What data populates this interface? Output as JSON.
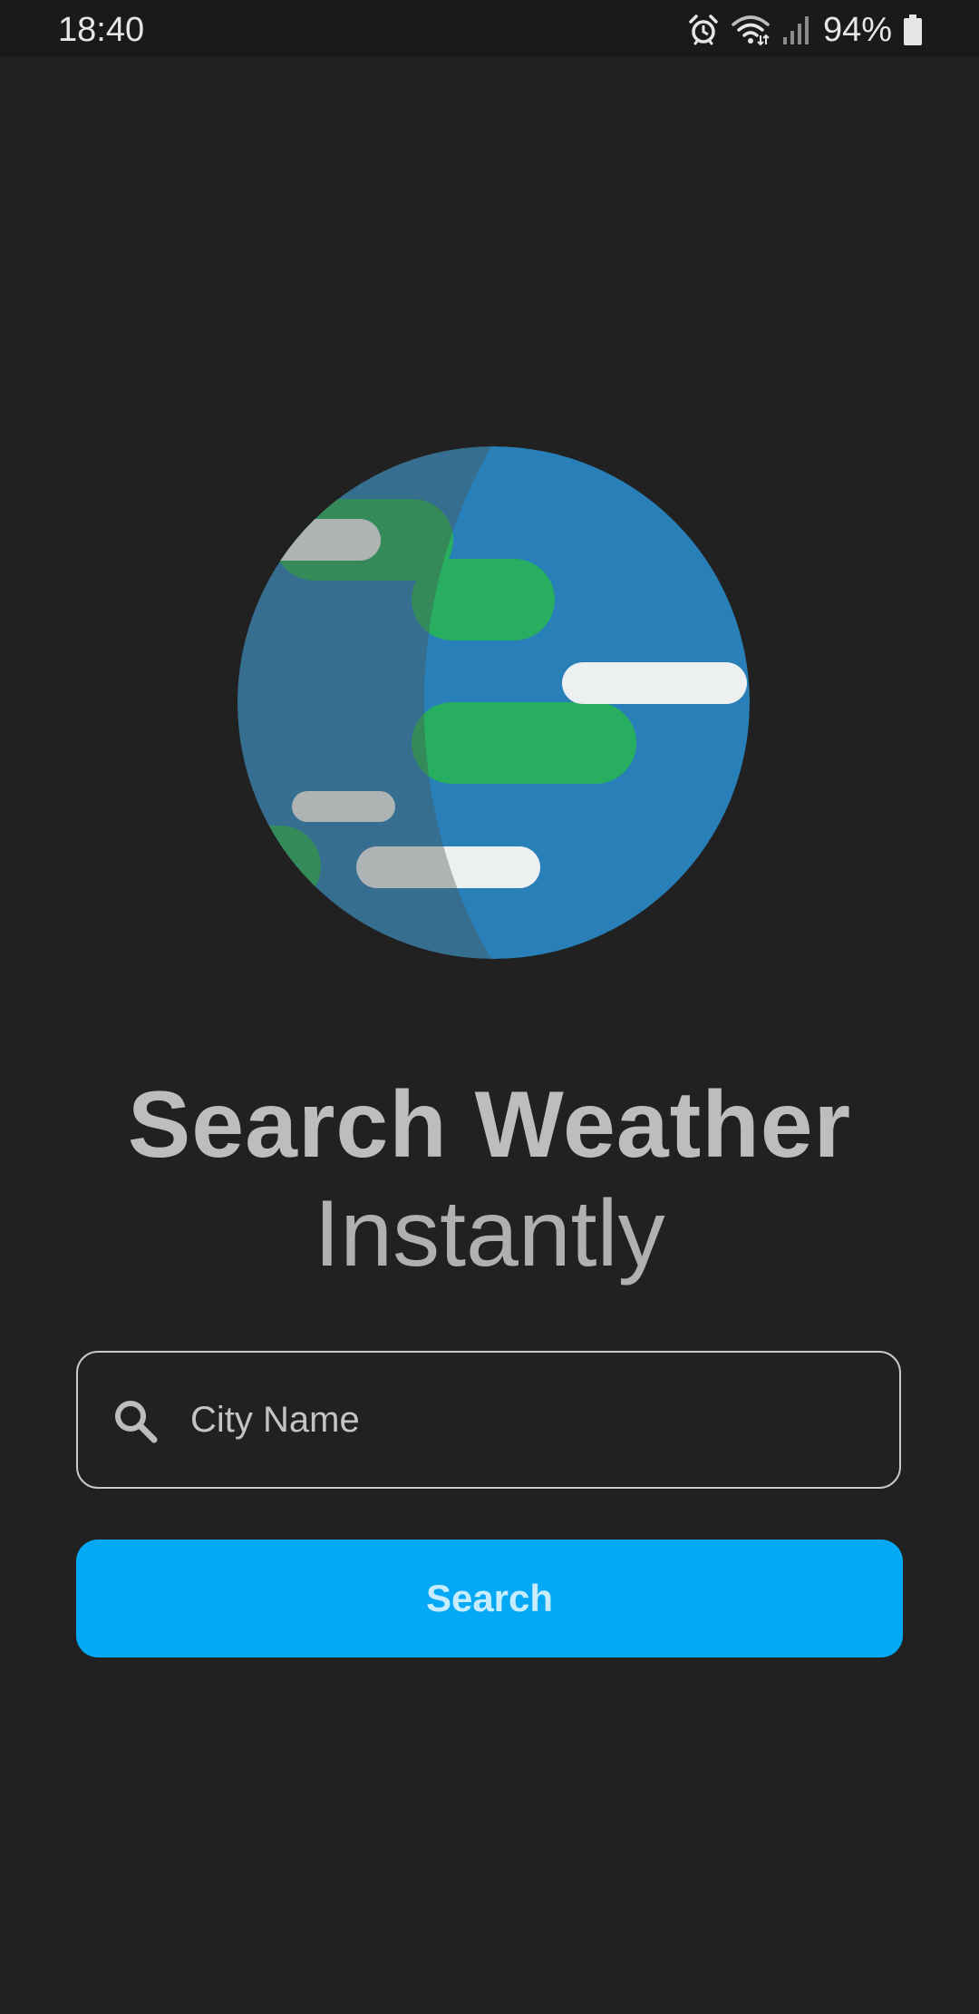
{
  "status_bar": {
    "time": "18:40",
    "battery_percent": "94%",
    "icons": [
      "alarm-icon",
      "wifi-icon",
      "signal-icon",
      "battery-icon"
    ]
  },
  "hero": {
    "illustration": "globe-illustration",
    "title": "Search Weather",
    "subtitle": "Instantly"
  },
  "search": {
    "placeholder": "City Name",
    "value": "",
    "icon": "search-icon"
  },
  "search_button": {
    "label": "Search"
  },
  "colors": {
    "background": "#212121",
    "accent": "#03a9f4",
    "text_muted": "#bdbdbd",
    "globe_ocean": "#2980b9",
    "globe_land": "#27ae60",
    "cloud": "#ecf0f1"
  }
}
